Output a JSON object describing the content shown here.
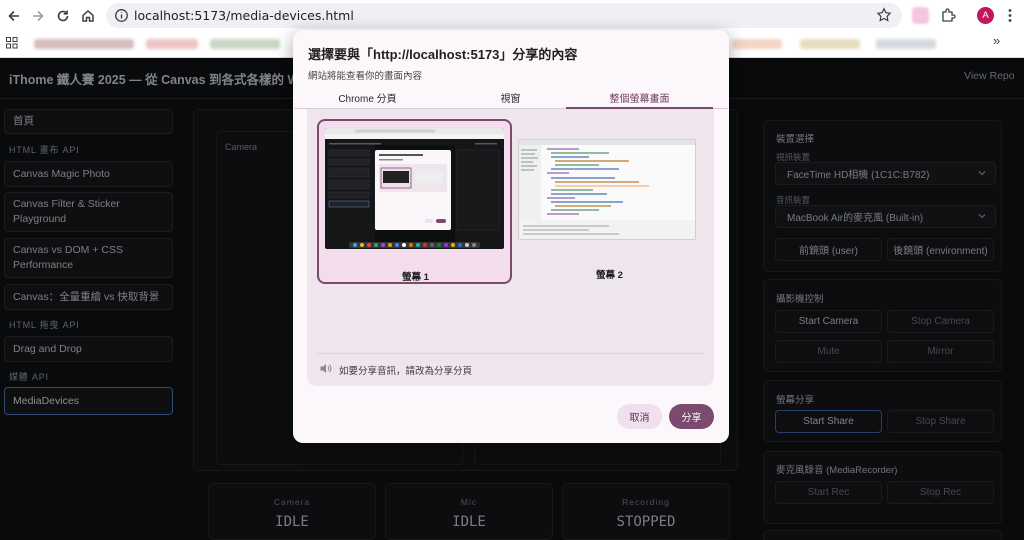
{
  "browser": {
    "url": "localhost:5173/media-devices.html",
    "avatar_letter": "A",
    "bookmarks_more": "»"
  },
  "page": {
    "title": "iThome 鐵人賽 2025 — 從 Canvas 到各式各樣的 Web",
    "view_repo": "View Repo",
    "sidebar": {
      "home": "首頁",
      "section_canvas": "HTML 畫布 API",
      "items_canvas": [
        "Canvas Magic Photo",
        "Canvas Filter & Sticker Playground",
        "Canvas vs DOM + CSS Performance",
        "Canvas：全量重繪 vs 快取背景"
      ],
      "section_dnd": "HTML 拖曳 API",
      "items_dnd": [
        "Drag and Drop"
      ],
      "section_media": "媒體 API",
      "items_media": [
        "MediaDevices"
      ]
    },
    "camera_label": "Camera",
    "states": [
      {
        "label": "Camera",
        "value": "IDLE"
      },
      {
        "label": "Mic",
        "value": "IDLE"
      },
      {
        "label": "Recording",
        "value": "STOPPED"
      }
    ],
    "right_panel": {
      "device_title": "裝置選擇",
      "video_label": "視訊裝置",
      "video_value": "FaceTime HD相機 (1C1C:B782)",
      "audio_label": "音訊裝置",
      "audio_value": "MacBook Air的麥克風 (Built-in)",
      "front_cam": "前鏡頭 (user)",
      "back_cam": "後鏡頭 (environment)",
      "camera_ctrl_title": "攝影機控制",
      "start_camera": "Start Camera",
      "stop_camera": "Stop Camera",
      "mute": "Mute",
      "mirror": "Mirror",
      "screen_share_title": "螢幕分享",
      "start_share": "Start Share",
      "stop_share": "Stop Share",
      "mic_rec_title": "麥克風錄音 (MediaRecorder)",
      "start_rec": "Start Rec",
      "stop_rec": "Stop Rec"
    }
  },
  "dialog": {
    "title": "選擇要與「http://localhost:5173」分享的內容",
    "subtitle": "網站將能查看你的畫面內容",
    "tabs": [
      "Chrome 分頁",
      "視窗",
      "整個螢幕畫面"
    ],
    "active_tab": 2,
    "screens": [
      "螢幕 1",
      "螢幕 2"
    ],
    "audio_note": "如要分享音訊，請改為分享分頁",
    "cancel": "取消",
    "share": "分享"
  },
  "colors": {
    "accent": "#7a4a6f",
    "selected_card_bg": "#f3dcec",
    "page_bg": "#101113",
    "active_sidebar_border": "#4f78b8"
  }
}
